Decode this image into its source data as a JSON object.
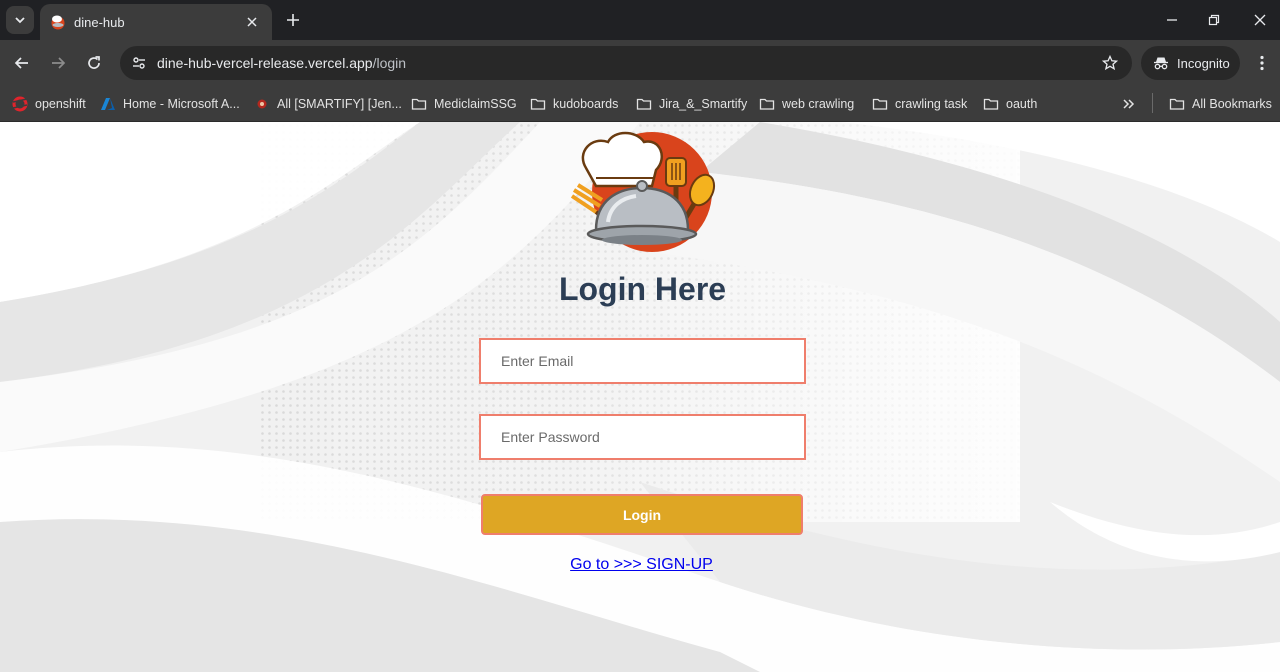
{
  "browser": {
    "tab": {
      "title": "dine-hub"
    },
    "url": {
      "host": "dine-hub-vercel-release.vercel.app",
      "path": "/login"
    },
    "incognito_label": "Incognito",
    "bookmarks": [
      {
        "label": "openshift",
        "icon": "openshift-icon"
      },
      {
        "label": "Home - Microsoft A...",
        "icon": "azure-icon"
      },
      {
        "label": "All [SMARTIFY] [Jen...",
        "icon": "jenkins-icon"
      },
      {
        "label": "MediclaimSSG",
        "icon": "folder-icon"
      },
      {
        "label": "kudoboards",
        "icon": "folder-icon"
      },
      {
        "label": "Jira_&_Smartify",
        "icon": "folder-icon"
      },
      {
        "label": "web crawling",
        "icon": "folder-icon"
      },
      {
        "label": "crawling task",
        "icon": "folder-icon"
      },
      {
        "label": "oauth",
        "icon": "folder-icon"
      }
    ],
    "all_bookmarks_label": "All Bookmarks"
  },
  "login": {
    "heading": "Login Here",
    "email_placeholder": "Enter Email",
    "password_placeholder": "Enter Password",
    "button_label": "Login",
    "signup_link": "Go to >>> SIGN-UP"
  },
  "colors": {
    "heading": "#2c3e55",
    "field_border": "#ef7e6c",
    "button_bg": "#dea624",
    "link": "#0000ee"
  }
}
